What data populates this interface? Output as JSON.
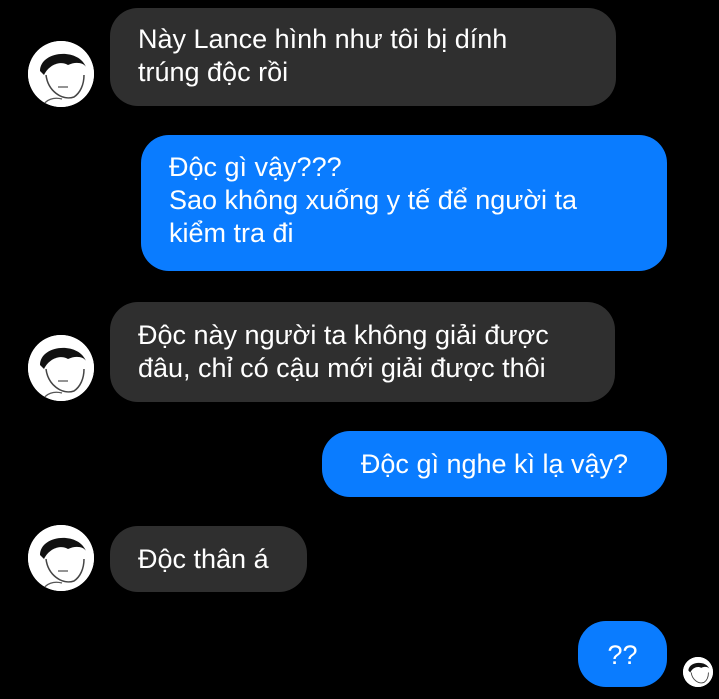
{
  "colors": {
    "background": "#000000",
    "incoming_bubble": "#2f2f2f",
    "outgoing_bubble": "#0a7cff",
    "text": "#ffffff"
  },
  "messages": [
    {
      "direction": "incoming",
      "text": "Này Lance hình như tôi bị dính\ntrúng độc rồi",
      "avatar": "avatar-icon"
    },
    {
      "direction": "outgoing",
      "text": "Độc gì vậy???\nSao không xuống y tế để người ta\nkiểm tra đi"
    },
    {
      "direction": "incoming",
      "text": "Độc này người ta không giải được\nđâu, chỉ có cậu mới giải được thôi",
      "avatar": "avatar-icon"
    },
    {
      "direction": "outgoing",
      "text": "Độc gì nghe kì lạ vậy?"
    },
    {
      "direction": "incoming",
      "text": "Độc thân á",
      "avatar": "avatar-icon"
    },
    {
      "direction": "outgoing",
      "text": "??"
    }
  ],
  "read_receipt": {
    "icon": "seen-avatar-icon"
  }
}
